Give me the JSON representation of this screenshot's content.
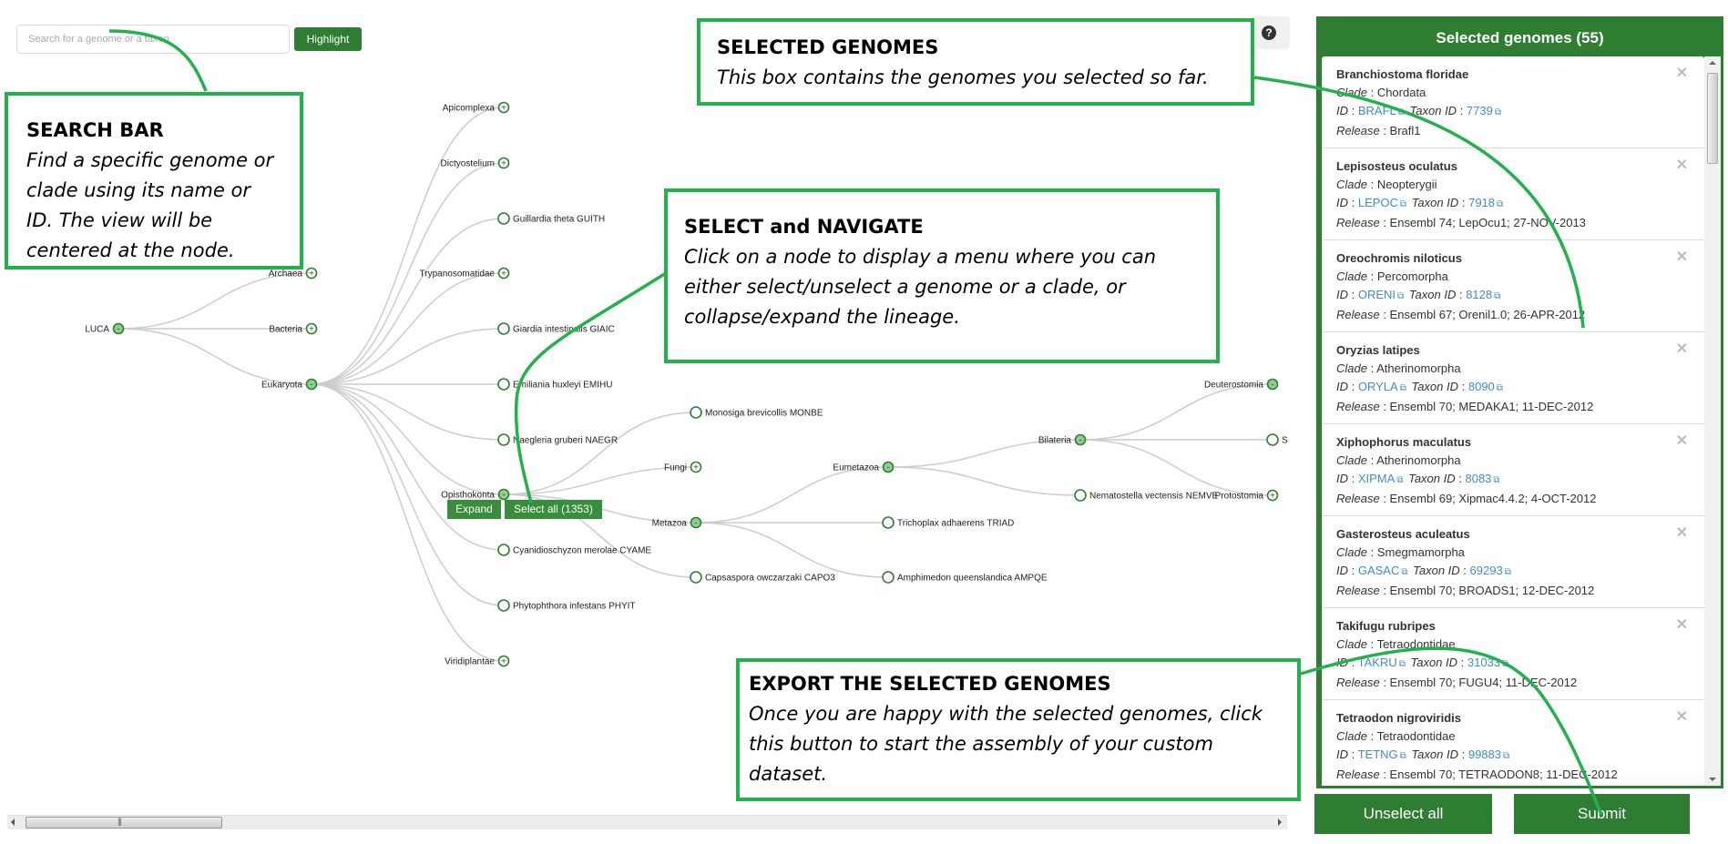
{
  "search": {
    "placeholder": "Search for a genome or a taxon",
    "value": "",
    "button_label": "Highlight"
  },
  "help": {
    "icon": "question-circle-icon",
    "label": "?"
  },
  "tree": {
    "nodes": [
      {
        "id": "luca",
        "label": "LUCA",
        "state": "expanded",
        "parent": null
      },
      {
        "id": "archaea",
        "label": "Archaea",
        "state": "collapsed",
        "parent": "luca"
      },
      {
        "id": "bacteria",
        "label": "Bacteria",
        "state": "collapsed",
        "parent": "luca"
      },
      {
        "id": "eukaryota",
        "label": "Eukaryota",
        "state": "expanded",
        "parent": "luca"
      },
      {
        "id": "apicomplexa",
        "label": "Apicomplexa",
        "state": "collapsed",
        "parent": "eukaryota"
      },
      {
        "id": "dictyostelium",
        "label": "Dictyostelium",
        "state": "collapsed",
        "parent": "eukaryota"
      },
      {
        "id": "guith",
        "label": "Guillardia theta GUITH",
        "state": "leaf",
        "parent": "eukaryota"
      },
      {
        "id": "trypanosomatidae",
        "label": "Trypanosomatidae",
        "state": "collapsed",
        "parent": "eukaryota"
      },
      {
        "id": "giaic",
        "label": "Giardia intestinalis GIAIC",
        "state": "leaf",
        "parent": "eukaryota"
      },
      {
        "id": "emihu",
        "label": "Emiliania huxleyi EMIHU",
        "state": "leaf",
        "parent": "eukaryota"
      },
      {
        "id": "naegr",
        "label": "Naegleria gruberi NAEGR",
        "state": "leaf",
        "parent": "eukaryota"
      },
      {
        "id": "opisthokonta",
        "label": "Opisthokonta",
        "state": "expanded",
        "parent": "eukaryota"
      },
      {
        "id": "cyame",
        "label": "Cyanidioschyzon merolae CYAME",
        "state": "leaf",
        "parent": "eukaryota"
      },
      {
        "id": "phyit",
        "label": "Phytophthora infestans PHYIT",
        "state": "leaf",
        "parent": "eukaryota"
      },
      {
        "id": "viridiplantae",
        "label": "Viridiplantae",
        "state": "collapsed",
        "parent": "eukaryota"
      },
      {
        "id": "monbe",
        "label": "Monosiga brevicollis MONBE",
        "state": "leaf",
        "parent": "opisthokonta"
      },
      {
        "id": "fungi",
        "label": "Fungi",
        "state": "collapsed",
        "parent": "opisthokonta"
      },
      {
        "id": "metazoa",
        "label": "Metazoa",
        "state": "expanded",
        "parent": "opisthokonta"
      },
      {
        "id": "capo3",
        "label": "Capsaspora owczarzaki CAPO3",
        "state": "leaf",
        "parent": "opisthokonta"
      },
      {
        "id": "eumetazoa",
        "label": "Eumetazoa",
        "state": "expanded",
        "parent": "metazoa"
      },
      {
        "id": "triad",
        "label": "Trichoplax adhaerens TRIAD",
        "state": "leaf",
        "parent": "metazoa"
      },
      {
        "id": "ampqe",
        "label": "Amphimedon queenslandica AMPQE",
        "state": "leaf",
        "parent": "metazoa"
      },
      {
        "id": "bilateria",
        "label": "Bilateria",
        "state": "expanded",
        "parent": "eumetazoa"
      },
      {
        "id": "nemve",
        "label": "Nematostella vectensis NEMVE",
        "state": "leaf",
        "parent": "eumetazoa"
      },
      {
        "id": "deuterostomia",
        "label": "Deuterostomia",
        "state": "expanded",
        "parent": "bilateria"
      },
      {
        "id": "s_leaf",
        "label": "S",
        "state": "leaf",
        "parent": "bilateria"
      },
      {
        "id": "protostomia",
        "label": "Protostomia",
        "state": "collapsed",
        "parent": "bilateria"
      }
    ],
    "node_menu": {
      "target": "Opisthokonta",
      "expand_label": "Expand",
      "select_all_label": "Select all (1353)"
    }
  },
  "panel": {
    "title": "Selected genomes (55)",
    "count": 55,
    "field_labels": {
      "clade": "Clade",
      "id": "ID",
      "taxon": "Taxon ID",
      "release": "Release",
      "sep": " : "
    },
    "genomes": [
      {
        "name": "Branchiostoma floridae",
        "clade": "Chordata",
        "id": "BRAFL",
        "taxon_id": "7739",
        "release": "Brafl1"
      },
      {
        "name": "Lepisosteus oculatus",
        "clade": "Neopterygii",
        "id": "LEPOC",
        "taxon_id": "7918",
        "release": "Ensembl 74; LepOcu1; 27-NOV-2013"
      },
      {
        "name": "Oreochromis niloticus",
        "clade": "Percomorpha",
        "id": "ORENI",
        "taxon_id": "8128",
        "release": "Ensembl 67; Orenil1.0; 26-APR-2012"
      },
      {
        "name": "Oryzias latipes",
        "clade": "Atherinomorpha",
        "id": "ORYLA",
        "taxon_id": "8090",
        "release": "Ensembl 70; MEDAKA1; 11-DEC-2012"
      },
      {
        "name": "Xiphophorus maculatus",
        "clade": "Atherinomorpha",
        "id": "XIPMA",
        "taxon_id": "8083",
        "release": "Ensembl 69; Xipmac4.4.2; 4-OCT-2012"
      },
      {
        "name": "Gasterosteus aculeatus",
        "clade": "Smegmamorpha",
        "id": "GASAC",
        "taxon_id": "69293",
        "release": "Ensembl 70; BROADS1; 12-DEC-2012"
      },
      {
        "name": "Takifugu rubripes",
        "clade": "Tetraodontidae",
        "id": "TAKRU",
        "taxon_id": "31033",
        "release": "Ensembl 70; FUGU4; 11-DEC-2012"
      },
      {
        "name": "Tetraodon nigroviridis",
        "clade": "Tetraodontidae",
        "id": "TETNG",
        "taxon_id": "99883",
        "release": "Ensembl 70; TETRAODON8; 11-DEC-2012"
      }
    ],
    "unselect_label": "Unselect all",
    "submit_label": "Submit"
  },
  "annotations": {
    "search": {
      "title": "SEARCH BAR",
      "text": "Find a specific genome or clade using its name or ID. The view will be centered at the node."
    },
    "selected": {
      "title": "SELECTED GENOMES",
      "text": "This box contains the genomes you selected so far."
    },
    "navigate": {
      "title": "SELECT and NAVIGATE",
      "text": "Click on a node to display a menu where you can either select/unselect a genome or a clade, or collapse/expand the lineage."
    },
    "export": {
      "title": "EXPORT THE SELECTED GENOMES",
      "text": "Once you are happy with the selected genomes, click this button to start the assembly of your custom dataset."
    }
  },
  "colors": {
    "brand_green": "#2e7d32",
    "annotation_green": "#22b14c",
    "link_blue": "#428bca",
    "node_fill_expanded": "#8fce8f"
  }
}
